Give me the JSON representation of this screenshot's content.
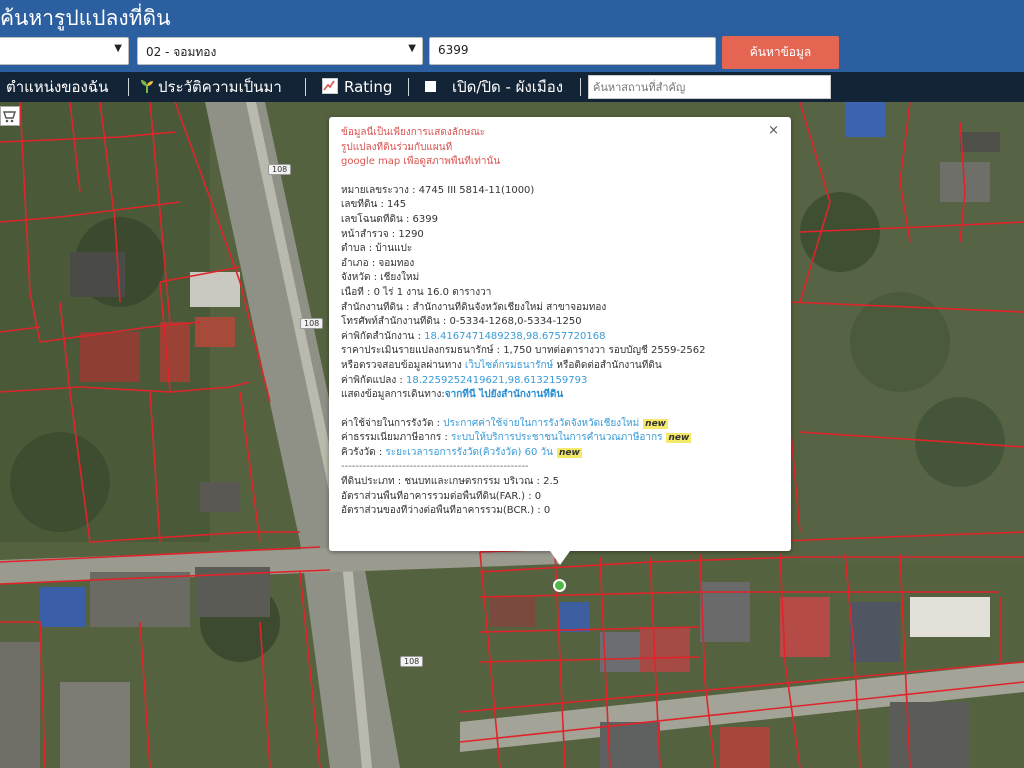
{
  "header": {
    "title": "ค้นหารูปแปลงที่ดิน",
    "district_select": "02 - จอมทอง",
    "deed_input": "6399",
    "search_button": "ค้นหาข้อมูล"
  },
  "nav": {
    "my_location": "ตำแหน่งของฉัน",
    "history": "ประวัติความเป็นมา",
    "rating": "Rating",
    "toggle_plan": "เปิด/ปิด - ผังเมือง",
    "place_placeholder": "ค้นหาสถานที่สำคัญ",
    "separator": "|"
  },
  "map": {
    "road_label_1": "108",
    "road_label_2": "108",
    "road_label_3": "108"
  },
  "popup": {
    "close": "×",
    "disclaimer": [
      "ข้อมูลนี้เป็นเพียงการแสดงลักษณะ",
      "รูปแปลงที่ดินร่วมกับแผนที่",
      "google map เพื่อดูสภาพพื้นที่เท่านั้น"
    ],
    "fields": [
      {
        "label": "หมายเลขระวาง : ",
        "value": "4745 III 5814-11(1000)"
      },
      {
        "label": "เลขที่ดิน : ",
        "value": "145"
      },
      {
        "label": "เลขโฉนดที่ดิน : ",
        "value": "6399"
      },
      {
        "label": "หน้าสำรวจ : ",
        "value": "1290"
      },
      {
        "label": "ตำบล : ",
        "value": "บ้านแปะ"
      },
      {
        "label": "อำเภอ : ",
        "value": "จอมทอง"
      },
      {
        "label": "จังหวัด : ",
        "value": "เชียงใหม่"
      },
      {
        "label": "เนื้อที่ : ",
        "value": "0 ไร่ 1 งาน 16.0 ตารางวา"
      },
      {
        "label": "สำนักงานที่ดิน : ",
        "value": "สำนักงานที่ดินจังหวัดเชียงใหม่ สาขาจอมทอง"
      },
      {
        "label": "โทรศัพท์สำนักงานที่ดิน : ",
        "value": "0-5334-1268,0-5334-1250"
      }
    ],
    "office_coord_label": "ค่าพิกัดสำนักงาน : ",
    "office_coord": "18.41674714892​38,98.6757720168",
    "appraisal_text": "ราคาประเมินรายแปลงกรมธนารักษ์ : 1,750 บาทต่อตารางวา รอบบัญชี 2559-2562",
    "verify_prefix": "หรือตรวจสอบข้อมูลผ่านทาง ",
    "verify_link": "เว็บไซต์กรมธนารักษ์",
    "verify_suffix": " หรือติดต่อสำนักงานที่ดิน",
    "parcel_coord_label": "ค่าพิกัดแปลง : ",
    "parcel_coord": "18.2259252419621,98.6132159793",
    "route_prefix": "แสดงข้อมูลการเดินทาง:",
    "route_link": "จากที่นี่ ไปยังสำนักงานที่ดิน",
    "fee_label": "ค่าใช้จ่ายในการรังวัด : ",
    "fee_link": "ประกาศค่าใช้จ่ายในการรังวัดจังหวัดเชียงใหม่",
    "tax_label": "ค่าธรรมเนียมภาษีอากร : ",
    "tax_link": "ระบบให้บริการประชาชนในการคำนวณภาษีอากร",
    "queue_label": "คิวรังวัด : ",
    "queue_link": "ระยะเวลารอการรังวัด(คิวรังวัด) 60 วัน",
    "new_badge": "new",
    "divider": "----------------------------------------------------",
    "zone": "ที่ดินประเภท : ชนบทและเกษตรกรรม บริเวณ : 2.5",
    "far": "อัตราส่วนพื้นที่อาคารรวมต่อพื้นที่ดิน(FAR.) : 0",
    "bcr": "อัตราส่วนของที่ว่างต่อพื้นที่อาคารรวม(BCR.) : 0"
  }
}
